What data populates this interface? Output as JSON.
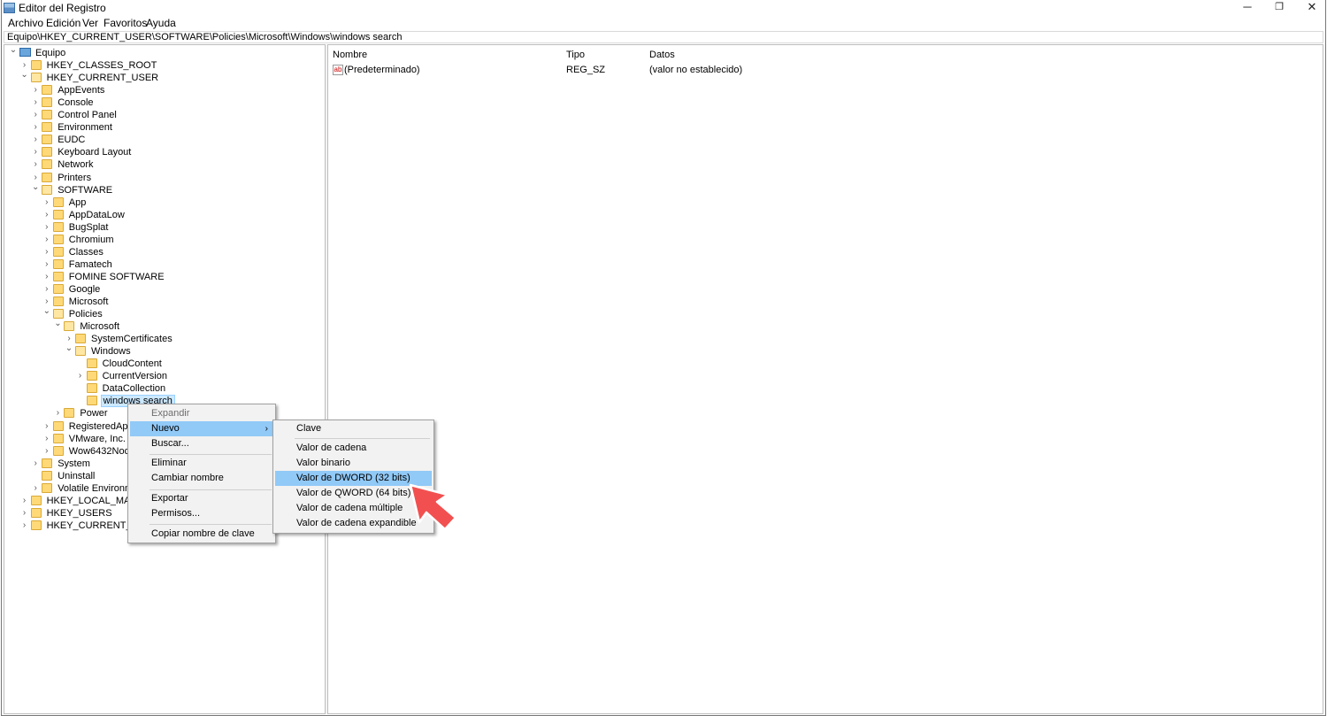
{
  "window": {
    "title": "Editor del Registro",
    "controls": {
      "minimize": "─",
      "maximize": "❐",
      "close": "✕"
    }
  },
  "menu": [
    "Archivo",
    "Edición",
    "Ver",
    "Favoritos",
    "Ayuda"
  ],
  "address": "Equipo\\HKEY_CURRENT_USER\\SOFTWARE\\Policies\\Microsoft\\Windows\\windows search",
  "tree": [
    {
      "label": "Equipo",
      "level": 0,
      "expanded": true
    },
    {
      "label": "HKEY_CLASSES_ROOT",
      "level": 1,
      "expanded": false
    },
    {
      "label": "HKEY_CURRENT_USER",
      "level": 1,
      "expanded": true
    },
    {
      "label": "AppEvents",
      "level": 2,
      "expanded": false
    },
    {
      "label": "Console",
      "level": 2,
      "expanded": false
    },
    {
      "label": "Control Panel",
      "level": 2,
      "expanded": false
    },
    {
      "label": "Environment",
      "level": 2,
      "expanded": false
    },
    {
      "label": "EUDC",
      "level": 2,
      "expanded": false
    },
    {
      "label": "Keyboard Layout",
      "level": 2,
      "expanded": false
    },
    {
      "label": "Network",
      "level": 2,
      "expanded": false
    },
    {
      "label": "Printers",
      "level": 2,
      "expanded": false
    },
    {
      "label": "SOFTWARE",
      "level": 2,
      "expanded": true
    },
    {
      "label": "App",
      "level": 3,
      "expanded": false
    },
    {
      "label": "AppDataLow",
      "level": 3,
      "expanded": false
    },
    {
      "label": "BugSplat",
      "level": 3,
      "expanded": false
    },
    {
      "label": "Chromium",
      "level": 3,
      "expanded": false
    },
    {
      "label": "Classes",
      "level": 3,
      "expanded": false
    },
    {
      "label": "Famatech",
      "level": 3,
      "expanded": false
    },
    {
      "label": "FOMINE SOFTWARE",
      "level": 3,
      "expanded": false
    },
    {
      "label": "Google",
      "level": 3,
      "expanded": false
    },
    {
      "label": "Microsoft",
      "level": 3,
      "expanded": false
    },
    {
      "label": "Policies",
      "level": 3,
      "expanded": true
    },
    {
      "label": "Microsoft",
      "level": 4,
      "expanded": true
    },
    {
      "label": "SystemCertificates",
      "level": 5,
      "expanded": false
    },
    {
      "label": "Windows",
      "level": 5,
      "expanded": true
    },
    {
      "label": "CloudContent",
      "level": 6,
      "expanded": null
    },
    {
      "label": "CurrentVersion",
      "level": 6,
      "expanded": false
    },
    {
      "label": "DataCollection",
      "level": 6,
      "expanded": null
    },
    {
      "label": "windows search",
      "level": 6,
      "expanded": null,
      "selected": true
    },
    {
      "label": "Power",
      "level": 4,
      "expanded": false
    },
    {
      "label": "RegisteredApplic",
      "level": 3,
      "expanded": false
    },
    {
      "label": "VMware, Inc.",
      "level": 3,
      "expanded": false
    },
    {
      "label": "Wow6432Node",
      "level": 3,
      "expanded": false
    },
    {
      "label": "System",
      "level": 2,
      "expanded": false
    },
    {
      "label": "Uninstall",
      "level": 2,
      "expanded": null
    },
    {
      "label": "Volatile Environmen",
      "level": 2,
      "expanded": false
    },
    {
      "label": "HKEY_LOCAL_MACHIN",
      "level": 1,
      "expanded": false
    },
    {
      "label": "HKEY_USERS",
      "level": 1,
      "expanded": false
    },
    {
      "label": "HKEY_CURRENT_CONF",
      "level": 1,
      "expanded": false
    }
  ],
  "list": {
    "headers": {
      "name": "Nombre",
      "type": "Tipo",
      "data": "Datos"
    },
    "rows": [
      {
        "icon": "ab",
        "name": "(Predeterminado)",
        "type": "REG_SZ",
        "data": "(valor no establecido)"
      }
    ]
  },
  "context_menu": {
    "expand": "Expandir",
    "new": "Nuevo",
    "find": "Buscar...",
    "delete": "Eliminar",
    "rename": "Cambiar nombre",
    "export": "Exportar",
    "permissions": "Permisos...",
    "copy_key_name": "Copiar nombre de clave"
  },
  "submenu": {
    "key": "Clave",
    "string": "Valor de cadena",
    "binary": "Valor binario",
    "dword": "Valor de DWORD (32 bits)",
    "qword": "Valor de QWORD (64 bits)",
    "multi_string": "Valor de cadena múltiple",
    "expand_string": "Valor de cadena expandible"
  },
  "colors": {
    "accent_arrow": "#f25050",
    "menu_highlight": "#91c9f7",
    "selection": "#cce8ff"
  }
}
